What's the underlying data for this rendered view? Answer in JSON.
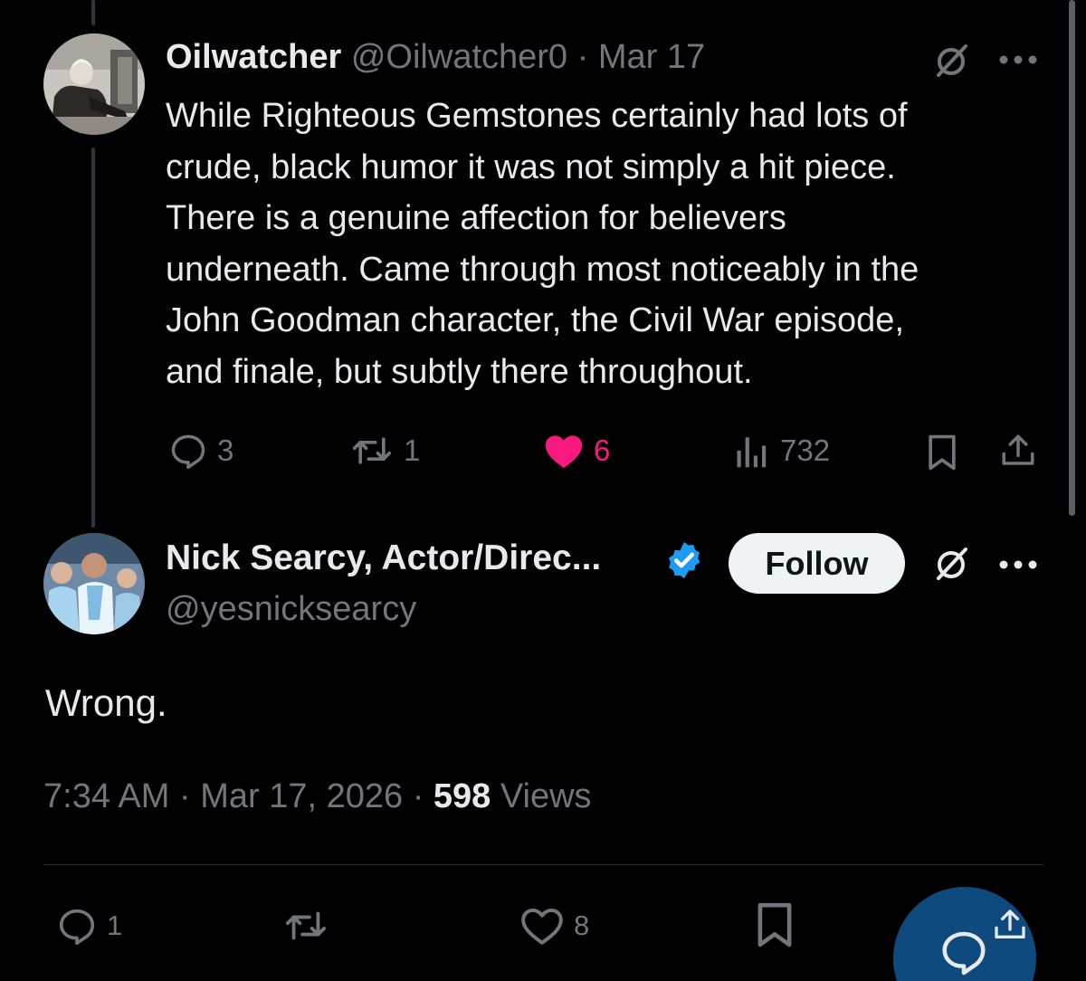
{
  "parent_tweet": {
    "display_name": "Oilwatcher",
    "handle": "@Oilwatcher0",
    "separator": "·",
    "date": "Mar 17",
    "text": "While Righteous Gemstones certainly had lots of\ncrude, black humor it was not simply a hit piece.\nThere is a genuine affection for believers\nunderneath. Came through most noticeably in the\nJohn Goodman character, the Civil War episode,\nand finale, but subtly there throughout.",
    "replies": "3",
    "reposts": "1",
    "likes": "6",
    "views": "732"
  },
  "main_tweet": {
    "display_name": "Nick Searcy, Actor/Direc...",
    "handle": "@yesnicksearcy",
    "follow_label": "Follow",
    "text": "Wrong.",
    "time": "7:34 AM",
    "date": "Mar 17, 2026",
    "separator": "·",
    "views_count": "598",
    "views_label": "Views",
    "replies": "1",
    "likes": "8"
  },
  "icons": {
    "reply": "reply-icon",
    "repost": "repost-icon",
    "like": "heart-icon",
    "views": "views-icon",
    "bookmark": "bookmark-icon",
    "share": "share-icon",
    "grok": "grok-icon",
    "more": "more-icon",
    "verified": "verified-badge-icon"
  },
  "colors": {
    "background": "#000000",
    "text_primary": "#e7e9ea",
    "text_secondary": "#71767b",
    "like_active": "#f91880",
    "verified_blue": "#1d9bf0",
    "follow_bg": "#eff3f4",
    "fab": "#0f4a7e"
  }
}
